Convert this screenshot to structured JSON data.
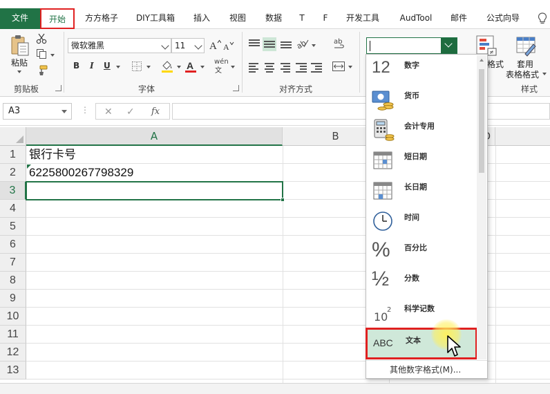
{
  "menu": {
    "file": "文件",
    "tabs": [
      "开始",
      "方方格子",
      "DIY工具箱",
      "插入",
      "视图",
      "数据",
      "T",
      "F",
      "开发工具",
      "AudTool",
      "邮件",
      "公式向导"
    ],
    "active_tab": "开始"
  },
  "ribbon": {
    "clipboard": {
      "paste": "粘贴",
      "label": "剪贴板"
    },
    "font": {
      "name": "微软雅黑",
      "size": "11",
      "bold": "B",
      "italic": "I",
      "underline": "U",
      "phonetic": "wén",
      "label": "字体"
    },
    "align": {
      "label": "对齐方式"
    },
    "number": {
      "value": ""
    },
    "styles": {
      "cond_fmt": "格式",
      "table_fmt_1": "套用",
      "table_fmt_2": "表格格式",
      "label": "样式"
    }
  },
  "formula_bar": {
    "name_box": "A3",
    "fx": "fx",
    "content": ""
  },
  "grid": {
    "columns": [
      "A",
      "B",
      "D"
    ],
    "selected_column": "A",
    "rows": [
      "1",
      "2",
      "3",
      "4",
      "5",
      "6",
      "7",
      "8",
      "9",
      "10",
      "11",
      "12",
      "13"
    ],
    "selected_row": "3",
    "cells": {
      "A1": "银行卡号",
      "A2": "6225800267798329"
    }
  },
  "number_format_menu": {
    "items": [
      {
        "label": "数字",
        "icon": "number-12-icon"
      },
      {
        "label": "货币",
        "icon": "currency-icon"
      },
      {
        "label": "会计专用",
        "icon": "accounting-icon"
      },
      {
        "label": "短日期",
        "icon": "calendar-short-icon"
      },
      {
        "label": "长日期",
        "icon": "calendar-long-icon"
      },
      {
        "label": "时间",
        "icon": "clock-icon"
      },
      {
        "label": "百分比",
        "icon": "percent-icon"
      },
      {
        "label": "分数",
        "icon": "fraction-icon"
      },
      {
        "label": "科学记数",
        "icon": "scientific-icon"
      },
      {
        "label": "文本",
        "icon": "abc-text-icon"
      }
    ],
    "big12": "12",
    "half": "½",
    "ten": "10",
    "sup": "2",
    "abc": "ABC",
    "percent": "%",
    "highlighted": "文本",
    "footer": "其他数字格式(M)..."
  },
  "colors": {
    "excel_green": "#217346",
    "highlight_red": "#e02020",
    "selected_fill": "#cfe8d9"
  }
}
